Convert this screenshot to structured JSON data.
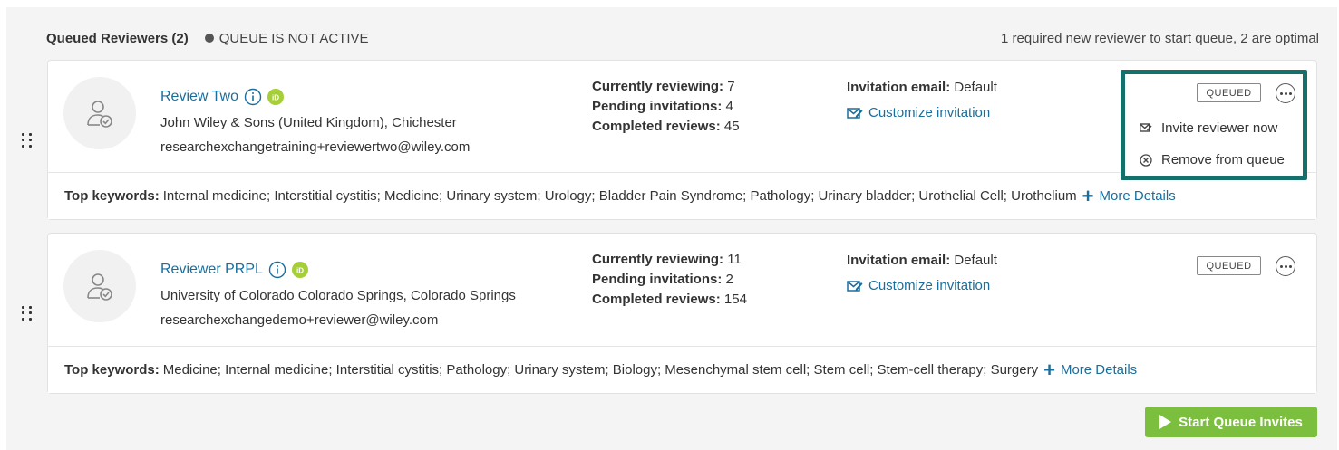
{
  "header": {
    "title": "Queued Reviewers (2)",
    "status": "QUEUE IS NOT ACTIVE",
    "note": "1 required new reviewer to start queue, 2 are optimal"
  },
  "reviewers": [
    {
      "name": "Review Two",
      "affiliation": "John Wiley & Sons (United Kingdom), Chichester",
      "email": "researchexchangetraining+reviewertwo@wiley.com",
      "currently_reviewing_label": "Currently reviewing:",
      "currently_reviewing": "7",
      "pending_label": "Pending invitations:",
      "pending": "4",
      "completed_label": "Completed reviews:",
      "completed": "45",
      "invitation_label": "Invitation email:",
      "invitation_value": "Default",
      "customize": "Customize invitation",
      "badge": "QUEUED",
      "keywords_label": "Top keywords:",
      "keywords": "Internal medicine; Interstitial cystitis; Medicine; Urinary system; Urology; Bladder Pain Syndrome; Pathology; Urinary bladder; Urothelial Cell; Urothelium",
      "more_details": "More Details"
    },
    {
      "name": "Reviewer PRPL",
      "affiliation": "University of Colorado Colorado Springs, Colorado Springs",
      "email": "researchexchangedemo+reviewer@wiley.com",
      "currently_reviewing_label": "Currently reviewing:",
      "currently_reviewing": "11",
      "pending_label": "Pending invitations:",
      "pending": "2",
      "completed_label": "Completed reviews:",
      "completed": "154",
      "invitation_label": "Invitation email:",
      "invitation_value": "Default",
      "customize": "Customize invitation",
      "badge": "QUEUED",
      "keywords_label": "Top keywords:",
      "keywords": "Medicine; Internal medicine; Interstitial cystitis; Pathology; Urinary system; Biology; Mesenchymal stem cell; Stem cell; Stem-cell therapy; Surgery",
      "more_details": "More Details"
    }
  ],
  "menu": {
    "invite_now": "Invite reviewer now",
    "remove": "Remove from queue"
  },
  "start_button": "Start Queue Invites",
  "colors": {
    "link": "#1a6e9c",
    "orcid": "#a6ce39",
    "highlight": "#156f6a",
    "start_button": "#7cbf3f"
  }
}
